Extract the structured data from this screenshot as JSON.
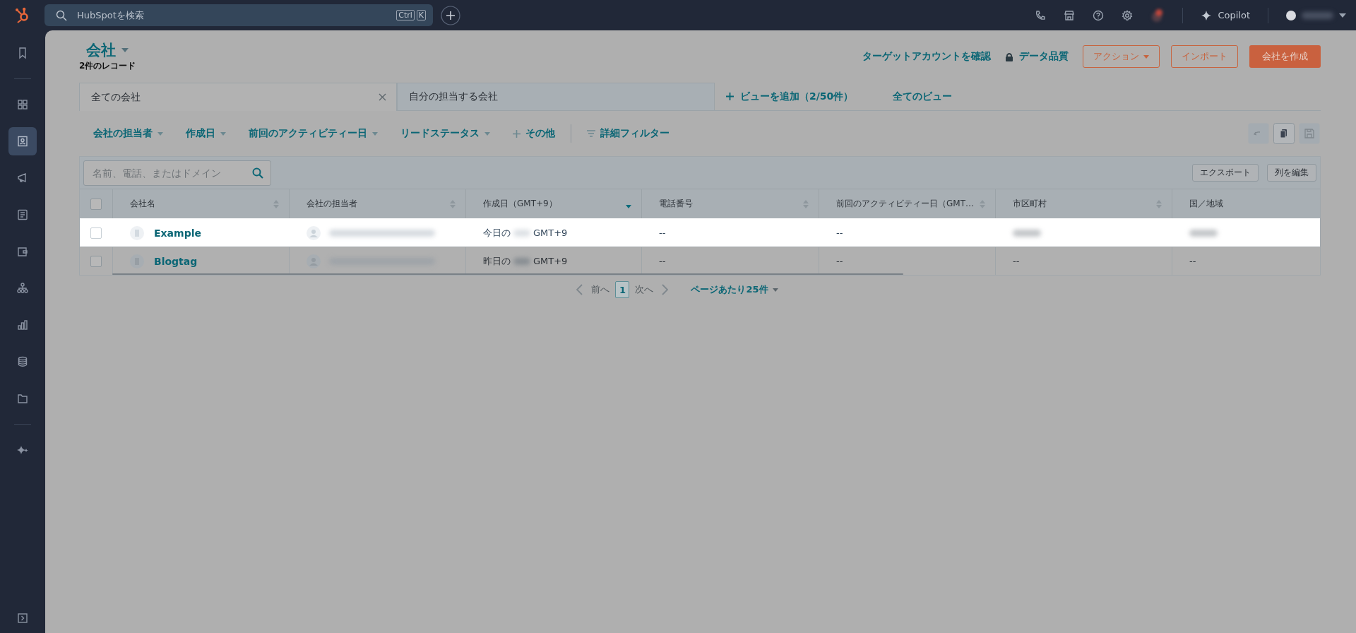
{
  "topbar": {
    "search": {
      "placeholder": "HubSpotを検索",
      "shortcut": [
        "Ctrl",
        "K"
      ]
    },
    "copilot": "Copilot"
  },
  "sidebar": {
    "items": [
      {
        "selected": false
      },
      {
        "selected": false
      },
      {
        "selected": true
      },
      {
        "selected": false
      },
      {
        "selected": false
      },
      {
        "selected": false
      },
      {
        "selected": false
      },
      {
        "selected": false
      },
      {
        "selected": false
      },
      {
        "selected": false
      },
      {
        "selected": false
      }
    ]
  },
  "page": {
    "title": "会社",
    "record_count": "2件のレコード",
    "links": [
      {
        "label": "ターゲットアカウントを確認",
        "kind": "plain"
      },
      {
        "label": "データ品質",
        "kind": "locked"
      }
    ],
    "buttons": [
      {
        "label": "アクション",
        "kind": "menu"
      },
      {
        "label": "インポート",
        "kind": "outline"
      },
      {
        "label": "会社を作成",
        "kind": "primary"
      }
    ]
  },
  "views": {
    "tabs": [
      {
        "label": "全ての会社",
        "selected": true,
        "closable": true
      },
      {
        "label": "自分の担当する会社",
        "selected": false,
        "closable": false
      }
    ],
    "add_view": "ビューを追加（2/50件）",
    "all_views": "全てのビュー"
  },
  "filters": [
    {
      "label": "会社の担当者",
      "kind": "dropdown"
    },
    {
      "label": "作成日",
      "kind": "dropdown"
    },
    {
      "label": "前回のアクティビティー日",
      "kind": "dropdown"
    },
    {
      "label": "リードステータス",
      "kind": "dropdown"
    },
    {
      "label": "その他",
      "kind": "add"
    },
    {
      "label": "詳細フィルター",
      "kind": "advanced"
    }
  ],
  "table": {
    "search": {
      "placeholder": "名前、電話、またはドメイン"
    },
    "toolbar_buttons": [
      "エクスポート",
      "列を編集"
    ],
    "header_checked": false,
    "columns": [
      {
        "label": "会社名",
        "sortable": true,
        "sorted": false
      },
      {
        "label": "会社の担当者",
        "sortable": true,
        "sorted": false
      },
      {
        "label": "作成日（GMT+9）",
        "sortable": true,
        "sorted": true
      },
      {
        "label": "電話番号",
        "sortable": true,
        "sorted": false
      },
      {
        "label": "前回のアクティビティー日（GMT…",
        "sortable": true,
        "sorted": false
      },
      {
        "label": "市区町村",
        "sortable": true,
        "sorted": false
      },
      {
        "label": "国／地域",
        "sortable": false,
        "sorted": false
      }
    ],
    "rows": [
      {
        "checked": false,
        "highlighted": true,
        "cells": [
          {
            "kind": "company",
            "text": "Example"
          },
          {
            "kind": "owner"
          },
          {
            "kind": "date",
            "prefix": "今日の",
            "suffix": "GMT+9"
          },
          {
            "kind": "text",
            "text": "--"
          },
          {
            "kind": "text",
            "text": "--"
          },
          {
            "kind": "redacted"
          },
          {
            "kind": "redacted"
          }
        ]
      },
      {
        "checked": false,
        "highlighted": false,
        "cells": [
          {
            "kind": "company",
            "text": "Blogtag"
          },
          {
            "kind": "owner"
          },
          {
            "kind": "date",
            "prefix": "昨日の",
            "suffix": "GMT+9"
          },
          {
            "kind": "text",
            "text": "--"
          },
          {
            "kind": "text",
            "text": "--"
          },
          {
            "kind": "text",
            "text": "--"
          },
          {
            "kind": "text",
            "text": "--"
          }
        ]
      }
    ]
  },
  "pagination": {
    "prev": "前へ",
    "prev_disabled": true,
    "pages": [
      {
        "label": "1",
        "selected": true
      }
    ],
    "next": "次へ",
    "next_disabled": true,
    "per_page": "ページあたり25件"
  }
}
